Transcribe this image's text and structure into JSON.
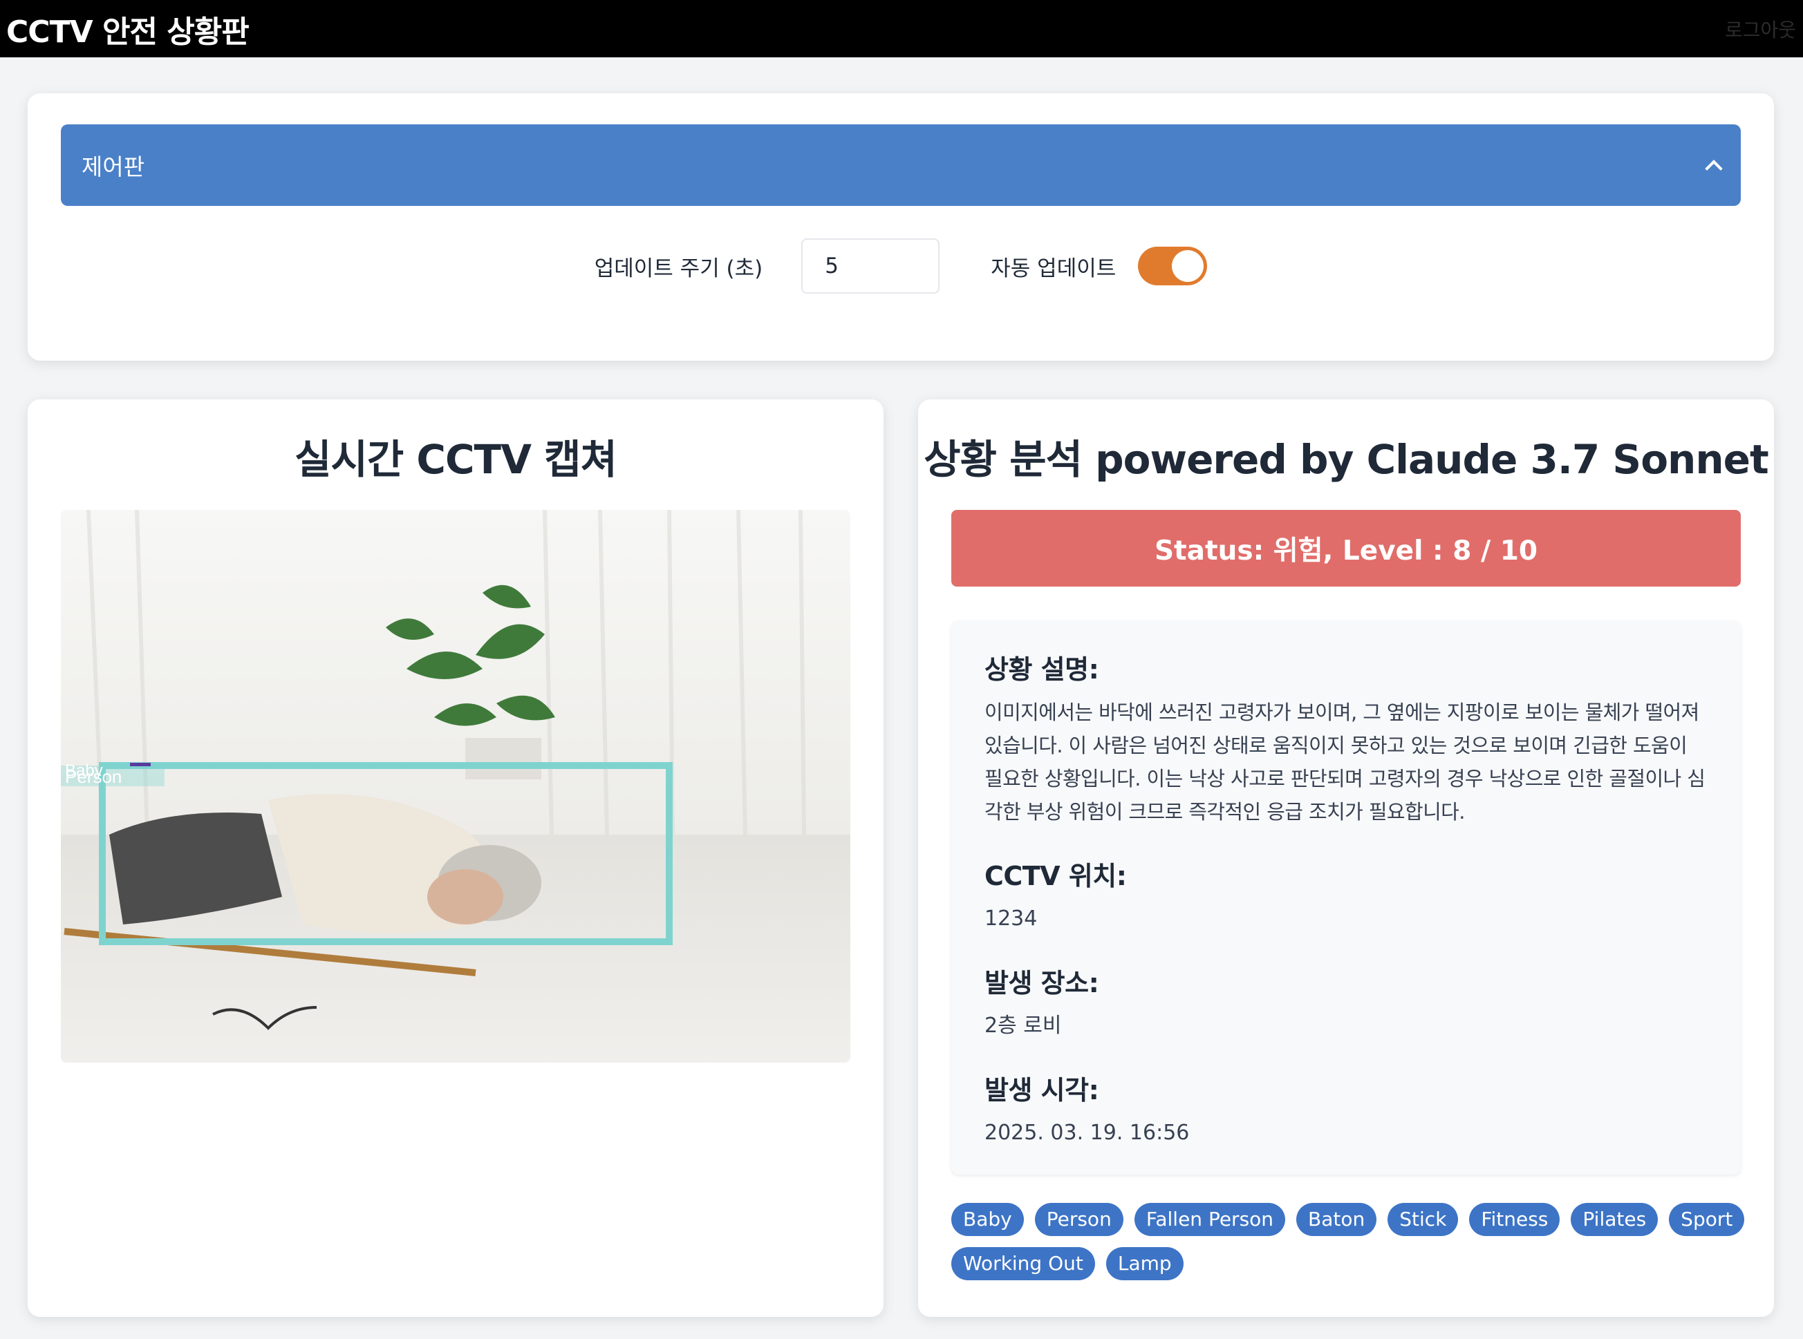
{
  "header": {
    "title": "CCTV 안전 상황판",
    "logout_label": "로그아웃"
  },
  "control_panel": {
    "title": "제어판",
    "interval_label": "업데이트 주기 (초)",
    "interval_value": "5",
    "auto_update_label": "자동 업데이트",
    "auto_update_on": true
  },
  "capture": {
    "title": "실시간 CCTV 캡쳐",
    "detections": [
      "Baby",
      "Person"
    ]
  },
  "analysis": {
    "title": "상황 분석 powered by Claude 3.7 Sonnet",
    "status_text": "Status: 위험, Level : 8 / 10",
    "status_color": "#e06d6a",
    "description_label": "상황 설명:",
    "description": "이미지에서는 바닥에 쓰러진 고령자가 보이며, 그 옆에는 지팡이로 보이는 물체가 떨어져 있습니다. 이 사람은 넘어진 상태로 움직이지 못하고 있는 것으로 보이며 긴급한 도움이 필요한 상황입니다. 이는 낙상 사고로 판단되며 고령자의 경우 낙상으로 인한 골절이나 심각한 부상 위험이 크므로 즉각적인 응급 조치가 필요합니다.",
    "cctv_location_label": "CCTV 위치:",
    "cctv_location": "1234",
    "place_label": "발생 장소:",
    "place": "2층 로비",
    "time_label": "발생 시각:",
    "time": "2025. 03. 19. 16:56",
    "tags": [
      "Baby",
      "Person",
      "Fallen Person",
      "Baton",
      "Stick",
      "Fitness",
      "Pilates",
      "Sport",
      "Working Out",
      "Lamp"
    ]
  },
  "colors": {
    "accent": "#4a80c8",
    "toggle": "#e07b2e",
    "tag": "#3d74c6",
    "detection_box": "#7fd3cf"
  }
}
